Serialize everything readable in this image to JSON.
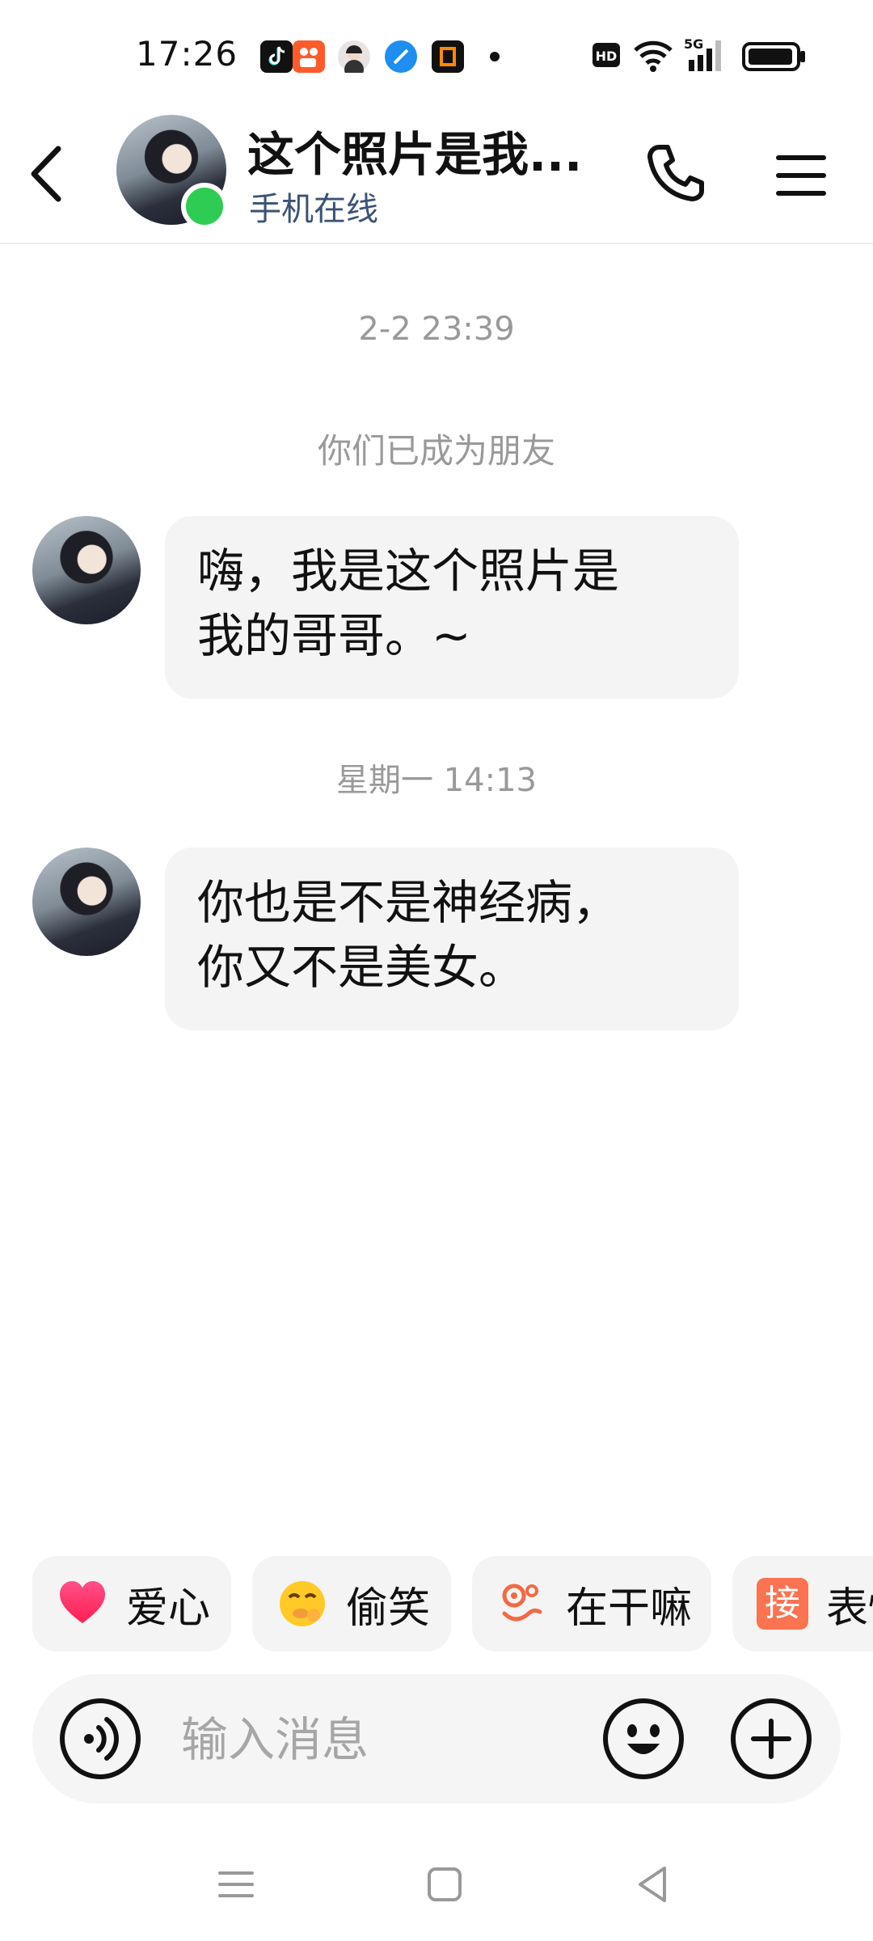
{
  "status_bar": {
    "time": "17:26",
    "apps": [
      "tiktok-icon",
      "kuaishou-icon",
      "avatar-app-icon",
      "browser-icon",
      "office-icon"
    ],
    "indicators": [
      "hd-icon",
      "wifi-icon",
      "5g-signal-icon",
      "battery-icon"
    ]
  },
  "header": {
    "title": "这个照片是我...",
    "status": "手机在线",
    "online_color": "#2ecc52"
  },
  "chat": {
    "timestamp_1": "2-2 23:39",
    "system_message": "你们已成为朋友",
    "message_1_line_1": "嗨，我是这个照片是",
    "message_1_line_2": "我的哥哥。~",
    "timestamp_2": "星期一 14:13",
    "message_2_line_1": "你也是不是神经病，",
    "message_2_line_2": "你又不是美女。"
  },
  "quick_replies": {
    "chip_1": "爱心",
    "chip_2": "偷笑",
    "chip_3": "在干嘛",
    "chip_4_icon_text": "接",
    "chip_4": "表情"
  },
  "input_bar": {
    "placeholder": "输入消息"
  },
  "colors": {
    "bubble": "#f4f4f4",
    "header_status": "#3b5275",
    "muted_text": "#999999"
  }
}
